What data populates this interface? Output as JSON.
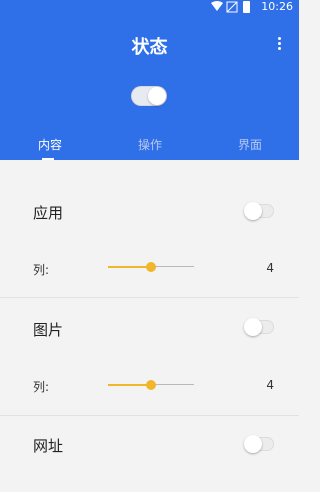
{
  "status_bar": {
    "time": "10:26",
    "icons": [
      "wifi-icon",
      "signal-icon",
      "battery-icon"
    ]
  },
  "header": {
    "title": "状态",
    "menu_icon": "more-vert-icon",
    "master_toggle_on": false
  },
  "tabs": [
    {
      "label": "内容",
      "active": true
    },
    {
      "label": "操作",
      "active": false
    },
    {
      "label": "界面",
      "active": false
    }
  ],
  "sections": [
    {
      "label": "应用",
      "toggle_on": false,
      "columns_label": "列:",
      "columns_value": "4",
      "slider_fraction": 0.5
    },
    {
      "label": "图片",
      "toggle_on": false,
      "columns_label": "列:",
      "columns_value": "4",
      "slider_fraction": 0.5
    },
    {
      "label": "网址",
      "toggle_on": false
    }
  ],
  "colors": {
    "primary": "#2f6fe8",
    "accent": "#f0b72a",
    "background": "#f3f3f3"
  }
}
